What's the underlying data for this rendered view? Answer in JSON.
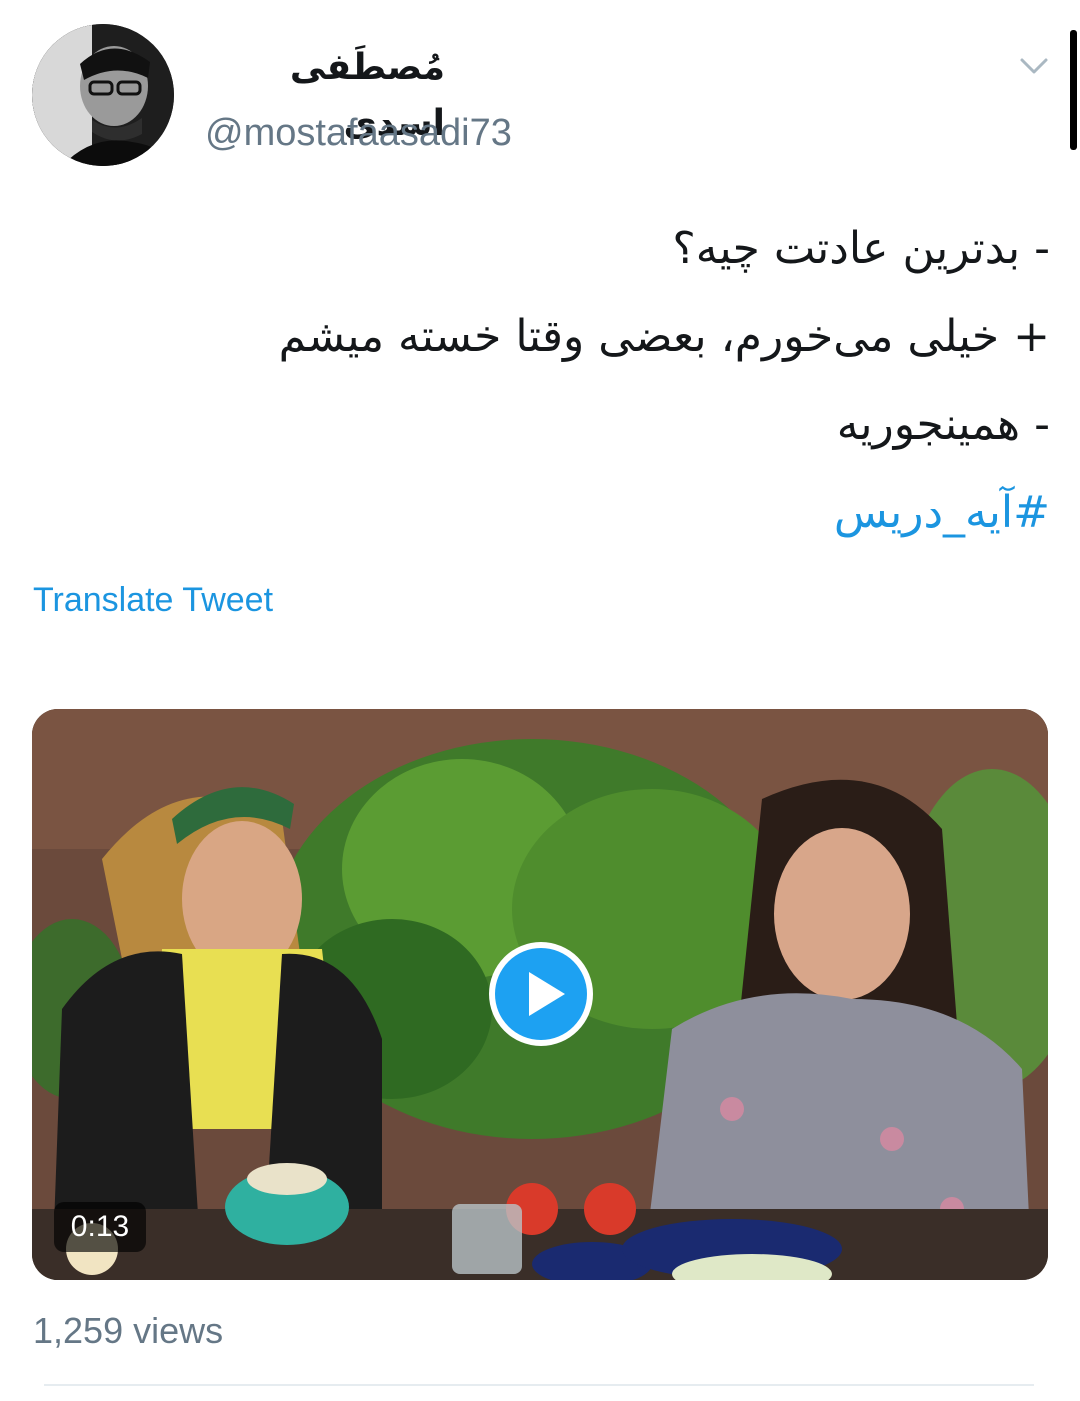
{
  "author": {
    "display_name": "مُصطَفی اسدی",
    "handle": "@mostafaasadi73"
  },
  "tweet": {
    "lines": [
      "- بدترین عادتت چیه؟",
      "+ خیلی می‌خورم، بعضی وقتا خسته میشم",
      "- همینجوریه"
    ],
    "hashtag": "#آیه_دریس",
    "translate_label": "Translate Tweet"
  },
  "media": {
    "duration": "0:13",
    "play_icon": "play-icon"
  },
  "stats": {
    "views": "1,259 views"
  },
  "colors": {
    "link": "#1b95e0",
    "play_button": "#1da1f2",
    "secondary_text": "#657786",
    "primary_text": "#14171a"
  }
}
